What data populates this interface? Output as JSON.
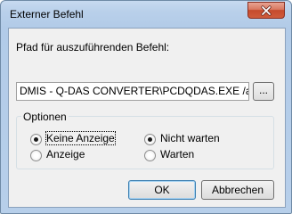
{
  "window": {
    "title": "Externer Befehl"
  },
  "form": {
    "path_label": "Pfad für auszuführenden Befehl:",
    "path_value": "DMIS - Q-DAS CONVERTER\\PCDQDAS.EXE /a",
    "browse_label": "..."
  },
  "options": {
    "legend": "Optionen",
    "radio_keine_anzeige": "Keine Anzeige",
    "radio_anzeige": "Anzeige",
    "radio_nicht_warten": "Nicht warten",
    "radio_warten": "Warten",
    "selected": [
      "Keine Anzeige",
      "Nicht warten"
    ]
  },
  "buttons": {
    "ok": "OK",
    "cancel": "Abbrechen"
  }
}
